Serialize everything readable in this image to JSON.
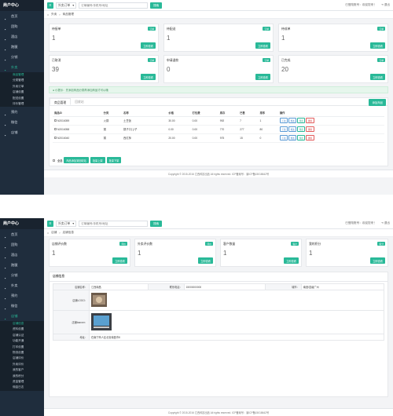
{
  "colors": {
    "accent": "#29b998",
    "sidebar": "#1f2d3d",
    "notice_bg": "#e6f6ec"
  },
  "shared": {
    "app_title": "商户中心",
    "search_select": "外卖订单",
    "search_placeholder": "订单编号/手机号/地址",
    "search_button": "搜索",
    "top_user": "已登陆账号：欢迎您来！",
    "top_exit": "退出",
    "copyright": "Copyright © 2015-2016 江西科技出品 All rights reserved. ICP备案号：渝ICP备15018642号"
  },
  "screen1": {
    "sidebar": [
      {
        "label": "首页",
        "icon": "home-icon"
      },
      {
        "label": "团购",
        "icon": "group-icon"
      },
      {
        "label": "酒店",
        "icon": "hotel-icon"
      },
      {
        "label": "跑腿",
        "icon": "errand-icon"
      },
      {
        "label": "分销",
        "icon": "share-icon"
      },
      {
        "label": "外卖",
        "icon": "takeout-icon",
        "active": true
      }
    ],
    "sidebar_sub": [
      "商品管理",
      "分类管理",
      "外卖订单",
      "店铺设置",
      "配送设置",
      "评价管理"
    ],
    "sidebar_after": [
      {
        "label": "预约",
        "icon": "calendar-icon"
      },
      {
        "label": "微信",
        "icon": "wechat-icon"
      },
      {
        "label": "店铺",
        "icon": "store-icon"
      }
    ],
    "breadcrumb": [
      "外卖",
      "商品管理"
    ],
    "cards": [
      {
        "title": "待接单",
        "badge": "订单",
        "value": "1",
        "button": "立即查看"
      },
      {
        "title": "待配送",
        "badge": "订单",
        "value": "1",
        "button": "立即查看"
      },
      {
        "title": "待成单",
        "badge": "订单",
        "value": "1",
        "button": "立即查看"
      },
      {
        "title": "已取消",
        "badge": "订单",
        "value": "39",
        "button": "立即查看"
      },
      {
        "title": "申请退款",
        "badge": "订单",
        "value": "0",
        "button": "立即查看"
      },
      {
        "title": "已完成",
        "badge": "订单",
        "value": "20",
        "button": "立即查看"
      }
    ],
    "notice": "小提示：先添加商品分类再添加商品才可以哦",
    "tabs": [
      "商品管理",
      "回收站"
    ],
    "add_button": "添加商品",
    "table_headers": [
      "商品ID",
      "分类",
      "名称",
      "价格",
      "打包费",
      "库存",
      "已售",
      "排序",
      "操作"
    ],
    "rows": [
      {
        "id": "N2016059",
        "cat": "火锅",
        "name": "土豆饭",
        "price": "30.00",
        "pack": "0.00",
        "stock": "992",
        "sold": "7",
        "sort": "1"
      },
      {
        "id": "N2016058",
        "cat": "锅",
        "name": "锅子口儿/子",
        "price": "0.00",
        "pack": "0.00",
        "stock": "770",
        "sold": "277",
        "sort": "80"
      },
      {
        "id": "N2016040",
        "cat": "锅",
        "name": "西红柿",
        "price": "20.00",
        "pack": "0.00",
        "stock": "975",
        "sold": "15",
        "sort": "0"
      }
    ],
    "row_ops": [
      "下架",
      "修改",
      "预览",
      "删除"
    ],
    "bulk_all": "全选",
    "bulk_buttons": [
      "商品添加到回收站",
      "批量上架",
      "批量下架"
    ]
  },
  "screen2": {
    "sidebar": [
      {
        "label": "首页",
        "icon": "home-icon"
      },
      {
        "label": "团购",
        "icon": "group-icon"
      },
      {
        "label": "酒店",
        "icon": "hotel-icon"
      },
      {
        "label": "跑腿",
        "icon": "errand-icon"
      },
      {
        "label": "分销",
        "icon": "share-icon"
      },
      {
        "label": "外卖",
        "icon": "takeout-icon"
      },
      {
        "label": "预约",
        "icon": "calendar-icon"
      },
      {
        "label": "微信",
        "icon": "wechat-icon"
      },
      {
        "label": "店铺",
        "icon": "store-icon",
        "active": true
      }
    ],
    "sidebar_sub": [
      "店铺信息",
      "资料设置",
      "店铺认证",
      "功能开通",
      "打印设置",
      "物流设置",
      "店铺评价",
      "外卖评价",
      "我的客户",
      "我的积分",
      "资金管理",
      "佣金日志"
    ],
    "breadcrumb": [
      "店铺",
      "店铺信息"
    ],
    "cards": [
      {
        "title": "店铺评价数",
        "badge": "评价",
        "value": "1",
        "button": "立即查看"
      },
      {
        "title": "外卖评价数",
        "badge": "评价",
        "value": "1",
        "button": "立即查看"
      },
      {
        "title": "客户数量",
        "badge": "客户",
        "value": "1",
        "button": "立即查看"
      },
      {
        "title": "我的积分",
        "badge": "积分",
        "value": "1",
        "button": "立即查看"
      }
    ],
    "panel_title": "店铺信息",
    "info": {
      "name_label": "店铺名称：",
      "name_value": "江西南昌",
      "phone_label": "联系电话：",
      "phone_value": "15000000000",
      "city_label": "城市：",
      "city_value": "南昌/县级广州",
      "logo_label": "店铺LOGO：",
      "banner_label": "店铺banner：",
      "addr_label": "地址：",
      "addr_value": "在南宁商人区北省南昌市8"
    }
  }
}
